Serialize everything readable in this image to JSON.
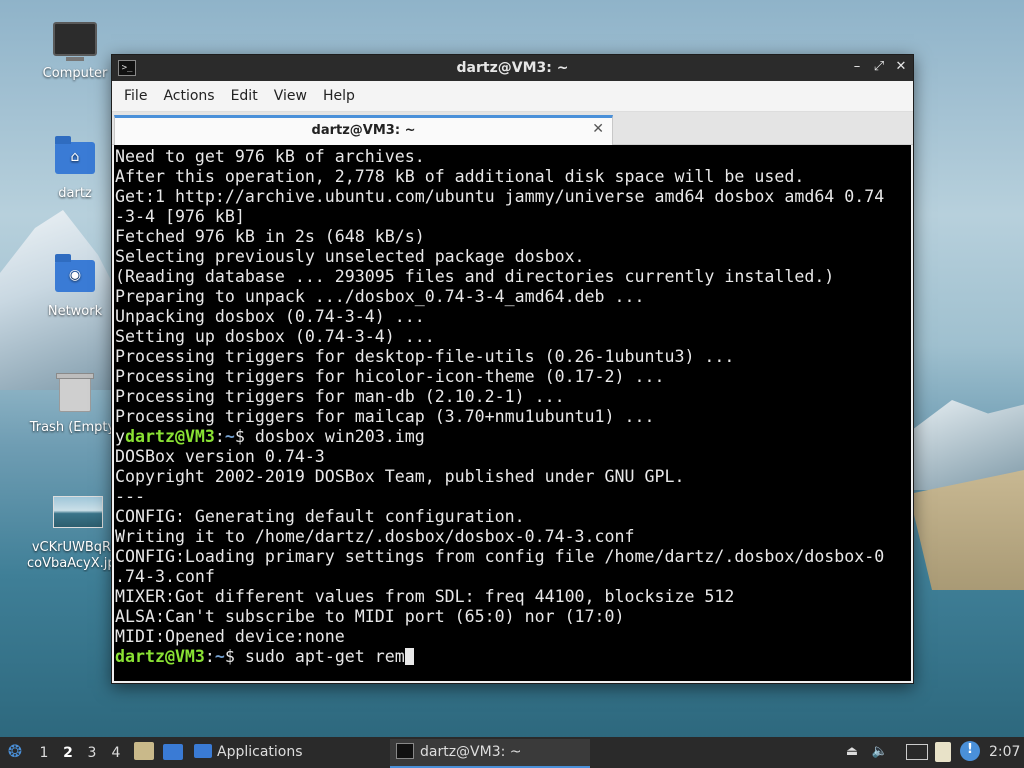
{
  "desktop": {
    "icons": [
      {
        "label": "Computer",
        "icon": "computer-icon"
      },
      {
        "label": "dartz",
        "icon": "home-folder-icon"
      },
      {
        "label": "Network",
        "icon": "network-folder-icon"
      },
      {
        "label": "Trash (Empty)",
        "icon": "trash-icon"
      },
      {
        "label": "vCKrUWBqRc coVbaAcyX.jpg",
        "icon": "image-file-icon"
      }
    ]
  },
  "window": {
    "title": "dartz@VM3: ~",
    "buttons": {
      "minimize": "–",
      "maximize": "⤢",
      "close": "✕"
    },
    "menu": [
      "File",
      "Actions",
      "Edit",
      "View",
      "Help"
    ],
    "tab": {
      "label": "dartz@VM3: ~",
      "close": "✕"
    }
  },
  "terminal": {
    "colors": {
      "prompt_user": "#8ae234",
      "prompt_path": "#729fcf",
      "text": "#e8e8e8",
      "background": "#000000"
    },
    "lines": [
      {
        "text": "Need to get 976 kB of archives."
      },
      {
        "text": "After this operation, 2,778 kB of additional disk space will be used."
      },
      {
        "text": "Get:1 http://archive.ubuntu.com/ubuntu jammy/universe amd64 dosbox amd64 0.74"
      },
      {
        "text": "-3-4 [976 kB]"
      },
      {
        "text": "Fetched 976 kB in 2s (648 kB/s)"
      },
      {
        "text": "Selecting previously unselected package dosbox."
      },
      {
        "text": "(Reading database ... 293095 files and directories currently installed.)"
      },
      {
        "text": "Preparing to unpack .../dosbox_0.74-3-4_amd64.deb ..."
      },
      {
        "text": "Unpacking dosbox (0.74-3-4) ..."
      },
      {
        "text": "Setting up dosbox (0.74-3-4) ..."
      },
      {
        "text": "Processing triggers for desktop-file-utils (0.26-1ubuntu3) ..."
      },
      {
        "text": "Processing triggers for hicolor-icon-theme (0.17-2) ..."
      },
      {
        "text": "Processing triggers for man-db (2.10.2-1) ..."
      },
      {
        "text": "Processing triggers for mailcap (3.70+nmu1ubuntu1) ..."
      },
      {
        "prefix": "y",
        "user": "dartz@VM3",
        "path": "~",
        "command": "dosbox win203.img"
      },
      {
        "text": "DOSBox version 0.74-3"
      },
      {
        "text": "Copyright 2002-2019 DOSBox Team, published under GNU GPL."
      },
      {
        "text": "---"
      },
      {
        "text": "CONFIG: Generating default configuration."
      },
      {
        "text": "Writing it to /home/dartz/.dosbox/dosbox-0.74-3.conf"
      },
      {
        "text": "CONFIG:Loading primary settings from config file /home/dartz/.dosbox/dosbox-0"
      },
      {
        "text": ".74-3.conf"
      },
      {
        "text": "MIXER:Got different values from SDL: freq 44100, blocksize 512"
      },
      {
        "text": "ALSA:Can't subscribe to MIDI port (65:0) nor (17:0)"
      },
      {
        "text": "MIDI:Opened device:none"
      },
      {
        "prefix": "",
        "user": "dartz@VM3",
        "path": "~",
        "command": "sudo apt-get rem",
        "cursor": true
      }
    ]
  },
  "taskbar": {
    "workspaces": [
      "1",
      "2",
      "3",
      "4"
    ],
    "active_workspace": "2",
    "applications_label": "Applications",
    "window_task": "dartz@VM3: ~",
    "clock": "2:07",
    "accent": "#4a90d9"
  }
}
